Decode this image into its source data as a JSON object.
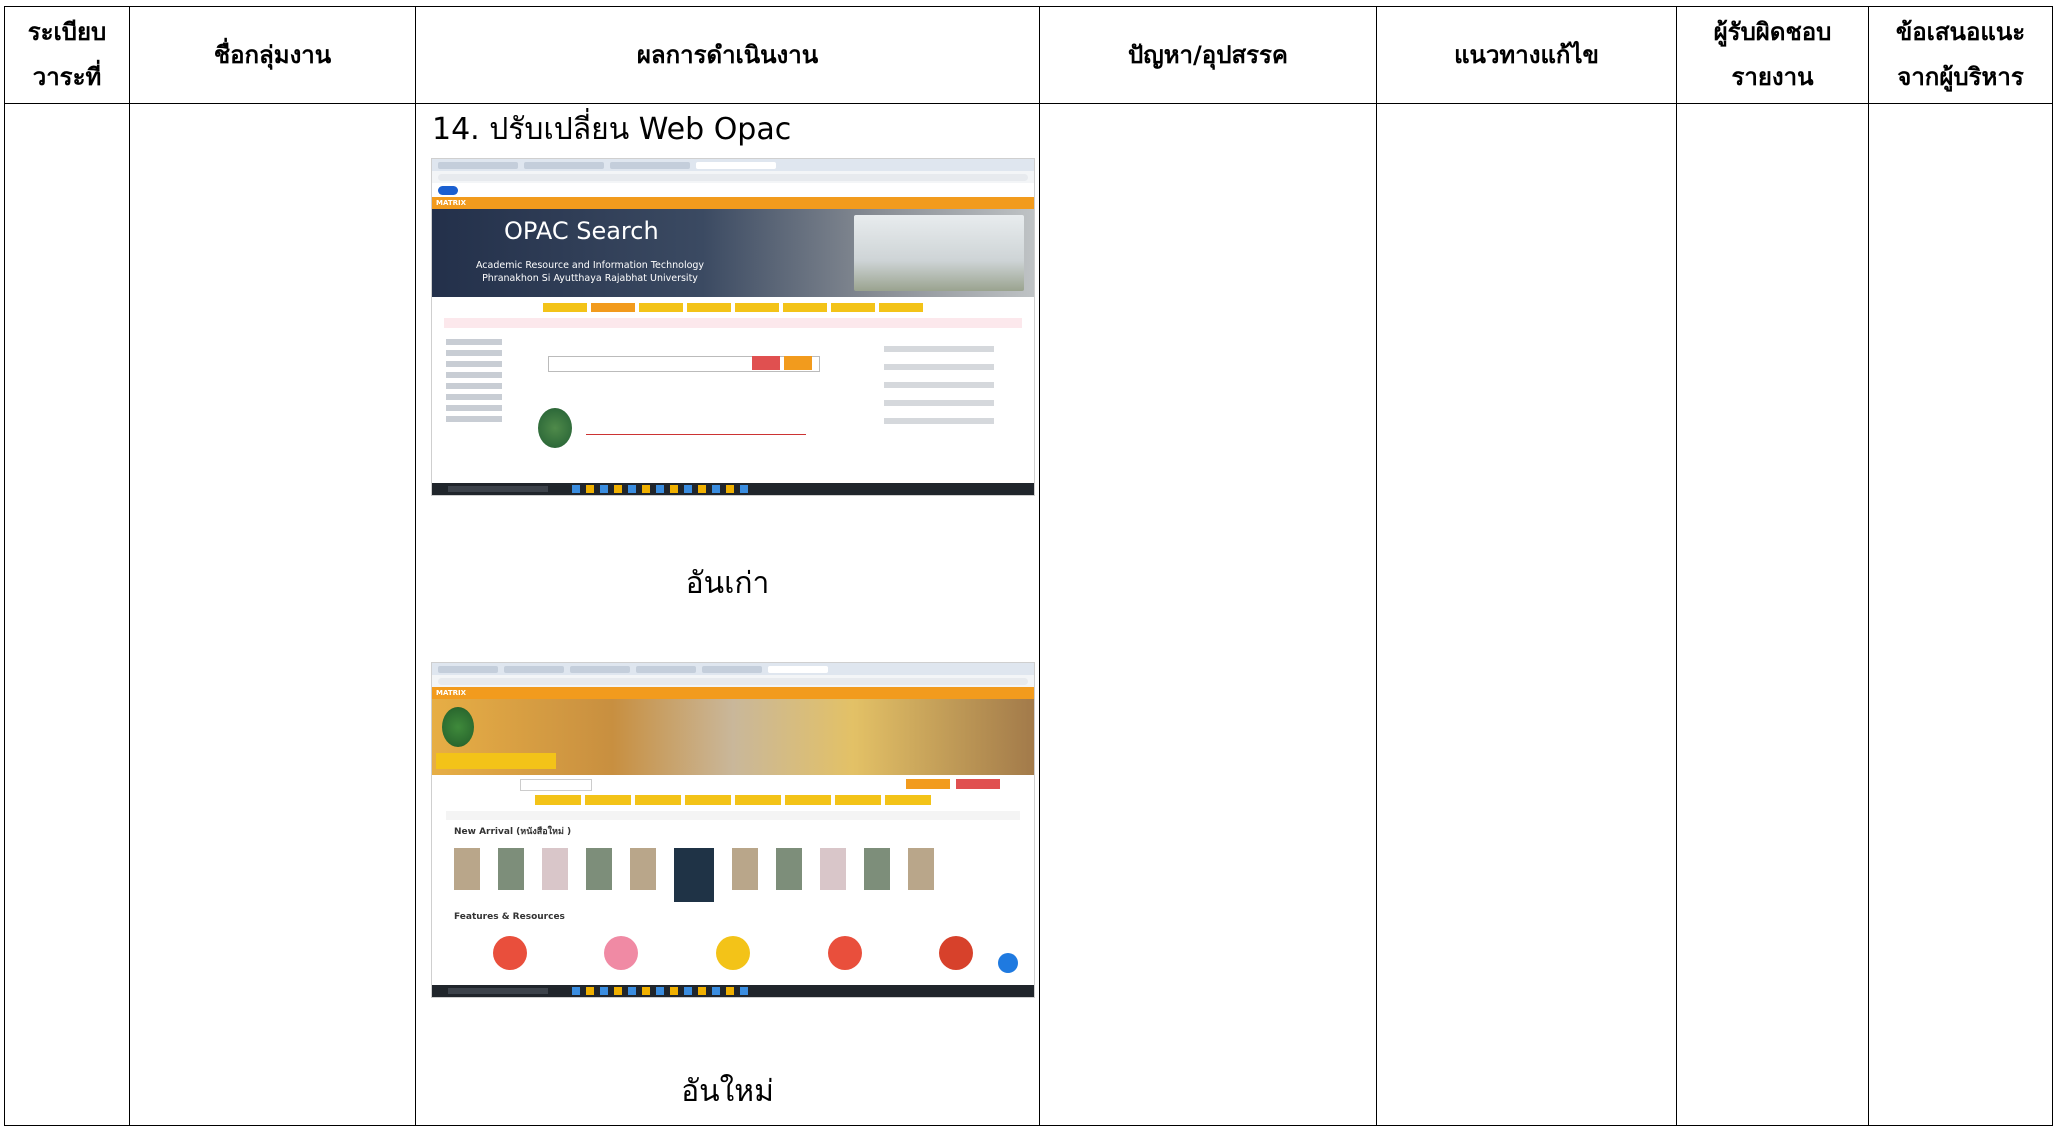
{
  "header": {
    "col_no": "ระเบียบ\nวาระที่",
    "col_group": "ชื่อกลุ่มงาน",
    "col_result": "ผลการดำเนินงาน",
    "col_problem": "ปัญหา/อุปสรรค",
    "col_solution": "แนวทางแก้ไข",
    "col_responsible": "ผู้รับผิดชอบ\nรายงาน",
    "col_suggestion": "ข้อเสนอแนะ\nจากผู้บริหาร"
  },
  "row": {
    "item_title": "14. ปรับเปลี่ยน  Web Opac",
    "old_screenshot": {
      "top_nav": "MATRIX",
      "banner_title": "OPAC Search",
      "banner_subtitle": "Academic Resource and Information Technology Phranakhon Si Ayutthaya Rajabhat University"
    },
    "caption_old": "อันเก่า",
    "new_screenshot": {
      "top_nav": "MATRIX",
      "section_title": "New Arrival (หนังสือใหม่ )",
      "features_title": "Features & Resources"
    },
    "caption_new": "อันใหม่"
  }
}
